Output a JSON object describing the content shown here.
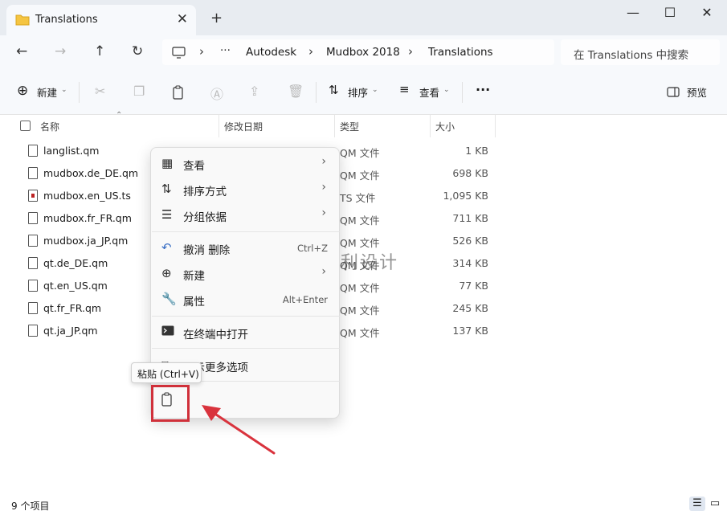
{
  "window": {
    "tab_title": "Translations",
    "tab_close": "✕",
    "new_tab": "+",
    "minimize": "—",
    "maximize": "☐",
    "close": "✕"
  },
  "nav": {
    "back": "←",
    "forward": "→",
    "up": "↑",
    "refresh": "↻",
    "breadcrumbs": [
      "Autodesk",
      "Mudbox 2018",
      "Translations"
    ],
    "overflow": "···",
    "search_placeholder": "在 Translations 中搜索"
  },
  "toolbar": {
    "new_label": "新建",
    "sort_label": "排序",
    "view_label": "查看",
    "more": "···",
    "preview_label": "预览"
  },
  "columns": {
    "name": "名称",
    "modified": "修改日期",
    "type": "类型",
    "size": "大小"
  },
  "files": [
    {
      "name": "langlist.qm",
      "type": "QM 文件",
      "size": "1 KB",
      "icon": "file"
    },
    {
      "name": "mudbox.de_DE.qm",
      "type": "QM 文件",
      "size": "698 KB",
      "icon": "file"
    },
    {
      "name": "mudbox.en_US.ts",
      "type": "TS 文件",
      "size": "1,095 KB",
      "icon": "ts-file"
    },
    {
      "name": "mudbox.fr_FR.qm",
      "type": "QM 文件",
      "size": "711 KB",
      "icon": "file"
    },
    {
      "name": "mudbox.ja_JP.qm",
      "type": "QM 文件",
      "size": "526 KB",
      "icon": "file"
    },
    {
      "name": "qt.de_DE.qm",
      "type": "QM 文件",
      "size": "314 KB",
      "icon": "file"
    },
    {
      "name": "qt.en_US.qm",
      "type": "QM 文件",
      "size": "77 KB",
      "icon": "file"
    },
    {
      "name": "qt.fr_FR.qm",
      "type": "QM 文件",
      "size": "245 KB",
      "icon": "file"
    },
    {
      "name": "qt.ja_JP.qm",
      "type": "QM 文件",
      "size": "137 KB",
      "icon": "file"
    }
  ],
  "context_menu": {
    "view": "查看",
    "sort_by": "排序方式",
    "group_by": "分组依据",
    "undo": "撤消 删除",
    "undo_shortcut": "Ctrl+Z",
    "new": "新建",
    "properties": "属性",
    "properties_shortcut": "Alt+Enter",
    "open_terminal": "在终端中打开",
    "show_more": "显示更多选项"
  },
  "tooltip": "粘贴 (Ctrl+V)",
  "status": {
    "count": "9 个项目"
  },
  "watermark": "雨利设计",
  "colors": {
    "highlight": "#d0303a",
    "arrow": "#d9333d",
    "chrome_bg": "#e8ecf1",
    "toolbar_bg": "#f7f9fc",
    "folder": "#f5c542"
  }
}
